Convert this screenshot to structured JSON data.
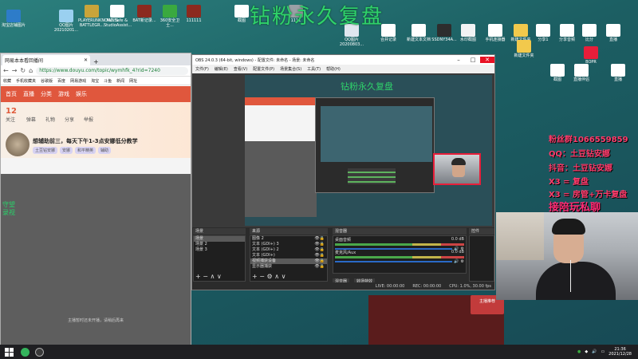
{
  "overlay_title": "钻粉永久复盘",
  "desktop_icons": [
    {
      "label": "淘宝店铺图片",
      "color": "#2d7cc9"
    },
    {
      "label": "QQ图片20210201...",
      "color": "#9ad0f0"
    },
    {
      "label": "PLAYERUNKNOWN'S BATTLEGR...",
      "color": "#c9a43a"
    },
    {
      "label": "MC Safe & StudioAssist...",
      "color": "#ffffff"
    },
    {
      "label": "BAT新记录...",
      "color": "#8b2a1f"
    },
    {
      "label": "360安全卫士...",
      "color": "#3aa93f"
    },
    {
      "label": "111111",
      "color": "#8b2a1f"
    },
    {
      "label": "截图",
      "color": "#ffffff"
    },
    {
      "label": "1111",
      "color": "#9aa0a6"
    },
    {
      "label": "QQ图片20200803...",
      "color": "#dfe6ef"
    },
    {
      "label": "合并记录",
      "color": "#ffffff"
    },
    {
      "label": "新建文本文档",
      "color": "#ffffff"
    },
    {
      "label": "SSDNY34A...",
      "color": "#2d2d2d"
    },
    {
      "label": "水印截图",
      "color": "#f1f3f4"
    },
    {
      "label": "手机连接器",
      "color": "#ffffff"
    },
    {
      "label": "新建文件夹",
      "color": "#f2c94c"
    },
    {
      "label": "分享1",
      "color": "#ffffff"
    },
    {
      "label": "分享音频",
      "color": "#ffffff"
    },
    {
      "label": "比分",
      "color": "#ffffff"
    },
    {
      "label": "直播",
      "color": "#ffffff"
    },
    {
      "label": "新建文件夹",
      "color": "#f2c94c"
    },
    {
      "label": "截图",
      "color": "#ffffff"
    },
    {
      "label": "直播伴侣",
      "color": "#ffffff"
    },
    {
      "label": "BOPR",
      "color": "#e81e3a"
    },
    {
      "label": "直播",
      "color": "#ffffff"
    }
  ],
  "promo_lines": [
    {
      "text": "粉丝群1066559859"
    },
    {
      "text": "QQ：土豆钻安娜"
    },
    {
      "text": "抖音：土豆钻安娜"
    },
    {
      "text": "X3 = 复盘"
    },
    {
      "text": "X3 = 房管+万卡复盘"
    },
    {
      "text": "接陪玩私聊"
    }
  ],
  "browser": {
    "tab_title": "网易本本看回播间",
    "url": "https://www.douyu.com/topic/wymhfk_4?rid=7240",
    "bookmarks": [
      "收藏",
      "手机收藏夹",
      "谷歌版",
      "百度",
      "网易游戏",
      "淘宝",
      "斗鱼",
      "新闻",
      "网址"
    ],
    "header_items": [
      "首页",
      "直播",
      "分类",
      "游戏",
      "娱乐"
    ],
    "stats": [
      {
        "value": "12",
        "label": "关注"
      },
      {
        "value": "",
        "label": "弹幕"
      },
      {
        "value": "",
        "label": "礼物"
      },
      {
        "value": "",
        "label": "分享"
      },
      {
        "value": "",
        "label": "举报"
      }
    ],
    "stream_title": "想辅助前三，每天下午1-3点安娜低分教学",
    "tags": [
      "土豆钻安娜",
      "安娜",
      "和平精英",
      "辅助"
    ],
    "bottom_text": "主播暂时还未开播，请稍后再来",
    "side_note": "守望\n录视"
  },
  "obs": {
    "window_title": "OBS 24.0.3 (64-bit, windows) - 配置文件: 未命名 - 场景: 未命名",
    "menu": [
      "文件(F)",
      "编辑(E)",
      "查看(V)",
      "配置文件(P)",
      "场景集合(S)",
      "工具(T)",
      "帮助(H)"
    ],
    "scenes_header": "场景",
    "scenes": [
      "场景",
      "场景 2",
      "场景 3"
    ],
    "sources_header": "来源",
    "sources": [
      "图像 2",
      "文本 (GDI+) 3",
      "文本 (GDI+) 2",
      "文本 (GDI+)",
      "视频捕获设备",
      "显示器捕获"
    ],
    "mixer_header": "混音器",
    "mixer": [
      {
        "name": "桌面音频",
        "level": "0.0 dB"
      },
      {
        "name": "麦克风/Aux",
        "level": "0.0 dB"
      }
    ],
    "mixer_tabs": [
      "混音器",
      "转场特效"
    ],
    "controls_header": "控件",
    "status": [
      "LIVE: 00:00:00",
      "REC: 00:00:00",
      "CPU: 1.0%, 30.00 fps"
    ]
  },
  "taskbar": {
    "apps": [
      {
        "name": "360-browser",
        "color": "#34b45c"
      },
      {
        "name": "obs",
        "color": "#3a3a3a"
      }
    ],
    "time": "21:36",
    "date": "2021/12/28"
  },
  "side_panel_badge": "主播推荐"
}
